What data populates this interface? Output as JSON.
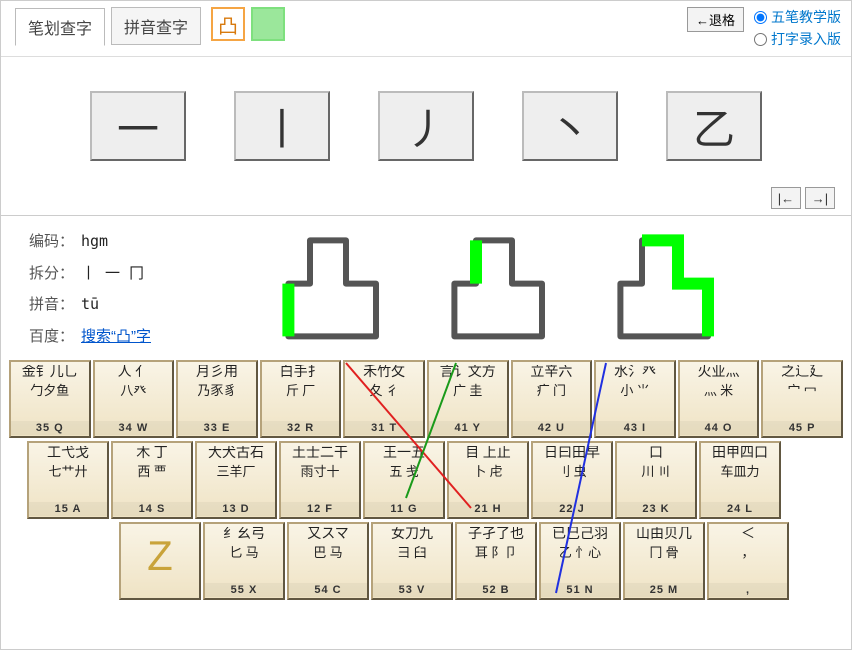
{
  "header": {
    "tabs": [
      {
        "id": "stroke",
        "label": "笔划查字",
        "active": true
      },
      {
        "id": "pinyin",
        "label": "拼音查字",
        "active": false
      }
    ],
    "current_char": "凸",
    "backspace_label": "←退格",
    "modes": [
      {
        "id": "teach",
        "label": "五笔教学版",
        "checked": true
      },
      {
        "id": "typing",
        "label": "打字录入版",
        "checked": false
      }
    ]
  },
  "strokes": [
    "一",
    "丨",
    "丿",
    "丶",
    "乙"
  ],
  "nav": {
    "prev": "|←",
    "next": "→|"
  },
  "info": {
    "code_label": "编码：",
    "code": "hgm",
    "split_label": "拆分：",
    "split": "丨 一 冂",
    "pinyin_label": "拼音：",
    "pinyin": "tū",
    "baidu_label": "百度：",
    "baidu_link": "搜索“凸”字"
  },
  "glyph_highlights": [
    "left-stroke",
    "top-stroke",
    "frame"
  ],
  "keyboard": {
    "rows": [
      [
        {
          "code": "35 Q",
          "r1": "金钅儿乚",
          "r2": "勹夕鱼"
        },
        {
          "code": "34 W",
          "r1": "人  亻",
          "r2": "八癶"
        },
        {
          "code": "33 E",
          "r1": "月彡用",
          "r2": "乃豕豸"
        },
        {
          "code": "32 R",
          "r1": "白手扌",
          "r2": "斤 厂"
        },
        {
          "code": "31 T",
          "r1": "禾竹攵",
          "r2": "夂 彳"
        },
        {
          "code": "41 Y",
          "r1": "言讠文方",
          "r2": "广 圭"
        },
        {
          "code": "42 U",
          "r1": "立辛六",
          "r2": "疒 门"
        },
        {
          "code": "43 I",
          "r1": "水氵癶",
          "r2": "小 ⺌"
        },
        {
          "code": "44 O",
          "r1": "火业灬",
          "r2": "灬 米"
        },
        {
          "code": "45 P",
          "r1": "之辶廴",
          "r2": "宀 冖"
        }
      ],
      [
        {
          "code": "15 A",
          "r1": "工弋戈",
          "r2": "七艹廾"
        },
        {
          "code": "14 S",
          "r1": "木  丁",
          "r2": "西  覀"
        },
        {
          "code": "13 D",
          "r1": "大犬古石",
          "r2": "三羊厂"
        },
        {
          "code": "12 F",
          "r1": "土士二干",
          "r2": "雨寸十"
        },
        {
          "code": "11 G",
          "r1": "王一五",
          "r2": "五 戋"
        },
        {
          "code": "21 H",
          "r1": "目 上止",
          "r2": "卜 虍"
        },
        {
          "code": "22 J",
          "r1": "日曰田早",
          "r2": "刂 虫"
        },
        {
          "code": "23 K",
          "r1": "口",
          "r2": "川  〣"
        },
        {
          "code": "24 L",
          "r1": "田甲四口",
          "r2": "车皿力"
        }
      ],
      [
        {
          "code": "Z",
          "z": true
        },
        {
          "code": "55 X",
          "r1": "纟幺弓",
          "r2": "匕 马"
        },
        {
          "code": "54 C",
          "r1": "又スマ",
          "r2": "巴  马"
        },
        {
          "code": "53 V",
          "r1": "女刀九",
          "r2": "彐 臼"
        },
        {
          "code": "52 B",
          "r1": "子孑了也",
          "r2": "耳 阝卩"
        },
        {
          "code": "51 N",
          "r1": "已巳己羽",
          "r2": "乙 忄心"
        },
        {
          "code": "25 M",
          "r1": "山由贝几",
          "r2": "冂 骨"
        },
        {
          "code": ",",
          "r1": "＜",
          "r2": "，"
        }
      ]
    ]
  }
}
